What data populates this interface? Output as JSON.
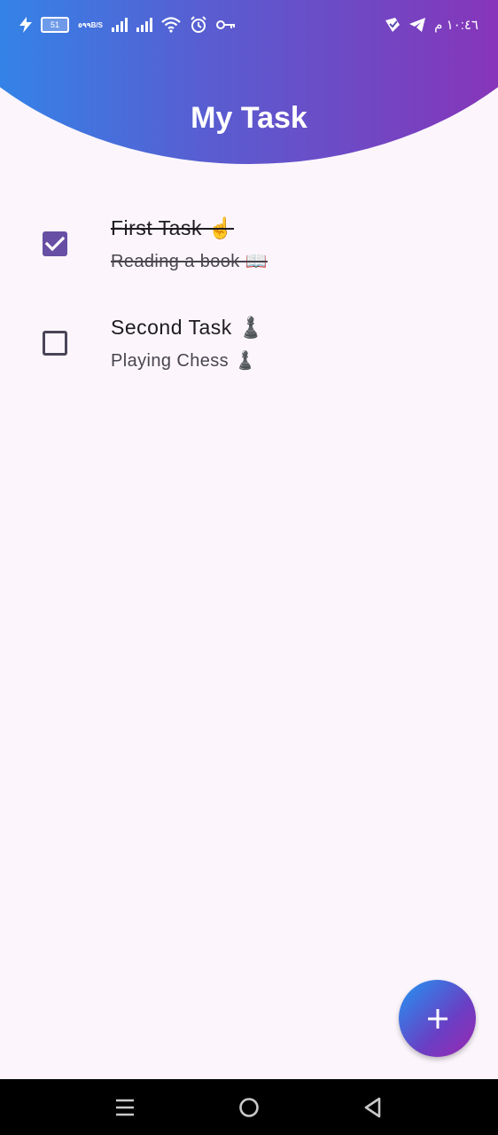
{
  "status_bar": {
    "battery_level": "51",
    "net_speed_value": "٥٩٩",
    "net_speed_unit": "B/S",
    "time": "١٠:٤٦ م",
    "icons": [
      "charging-icon",
      "battery-icon",
      "signal-icon",
      "signal-icon",
      "wifi-icon",
      "alarm-icon",
      "key-icon",
      "vpn-icon",
      "telegram-icon"
    ]
  },
  "header": {
    "title": "My Task",
    "gradient_start": "#2196f3",
    "gradient_end": "#9c27b0"
  },
  "tasks": [
    {
      "title": "First Task ☝️",
      "subtitle": "Reading a book 📖",
      "completed": true
    },
    {
      "title": "Second Task  ♟️",
      "subtitle": "Playing Chess ♟️",
      "completed": false
    }
  ],
  "fab": {
    "icon": "plus-icon",
    "label": "+"
  },
  "nav_bar": {
    "icons": [
      "recents-icon",
      "home-icon",
      "back-icon"
    ]
  },
  "colors": {
    "background": "#fcf6fc",
    "checkbox_checked": "#6750a4",
    "nav_bar": "#000000"
  }
}
